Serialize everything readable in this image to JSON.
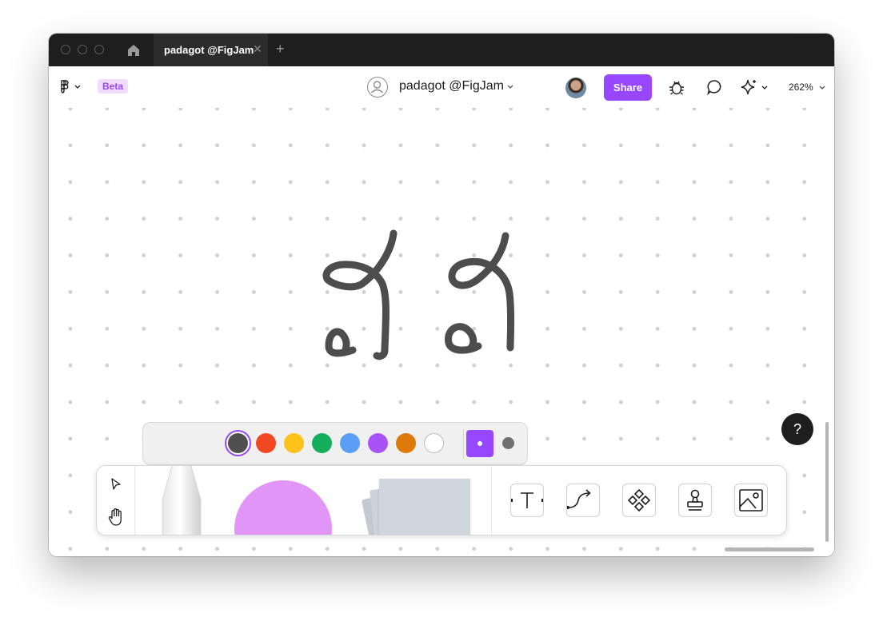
{
  "titlebar": {
    "tab_label": "padagot @FigJam",
    "tab_close": "✕",
    "new_tab": "+"
  },
  "toolbar": {
    "beta_label": "Beta",
    "file_title": "padagot @FigJam",
    "share_label": "Share",
    "zoom_label": "262%"
  },
  "canvas": {
    "help_label": "?"
  },
  "palette": {
    "colors": [
      "#505050",
      "#f24822",
      "#ffc21a",
      "#14ae5c",
      "#5a9ff5",
      "#a853f7",
      "#de7a0a",
      "#ffffff"
    ],
    "selected_color": "#505050",
    "accent": "#9747ff"
  },
  "tools": [
    "move-tool",
    "hand-tool",
    "pen-tool",
    "shape-tool",
    "sticky-note-tool",
    "text-tool",
    "connector-tool",
    "components-tool",
    "stamp-tool",
    "image-tool"
  ]
}
